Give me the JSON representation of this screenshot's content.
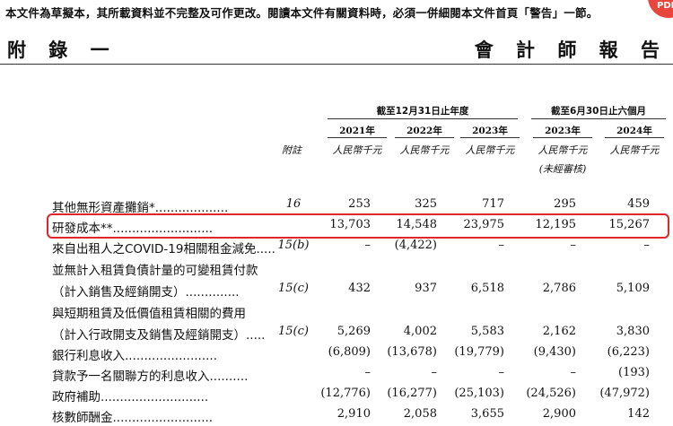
{
  "header": {
    "disclaimer": "本文件為草擬本，其所載資料並不完整及可作更改。閱讀本文件有關資料時，必須一併細閱本文件首頁「警告」一節。",
    "section_left": "附 錄 一",
    "section_right": "會 計 師 報 告"
  },
  "columns": {
    "group_year_end": "截至12月31日止年度",
    "group_six_months": "截至6月30日止六個月",
    "note_header": "附註",
    "years": [
      "2021年",
      "2022年",
      "2023年",
      "2023年",
      "2024年"
    ],
    "unit": "人民幣千元",
    "unaudited": "(未經審核)"
  },
  "rows": [
    {
      "label": "其他無形資產攤銷*...................",
      "note": "16",
      "values": [
        "253",
        "325",
        "717",
        "295",
        "459"
      ]
    },
    {
      "label": "研發成本**..........................",
      "note": "",
      "values": [
        "13,703",
        "14,548",
        "23,975",
        "12,195",
        "15,267"
      ]
    },
    {
      "label": "來自出租人之COVID-19相關租金減免.....",
      "note": "15(b)",
      "values": [
        "–",
        "(4,422)",
        "–",
        "–",
        "–"
      ]
    },
    {
      "label": "並無計入租賃負債計量的可變租賃付款",
      "note": "",
      "values": [
        "",
        "",
        "",
        "",
        ""
      ]
    },
    {
      "label": "（計入銷售及經銷開支）..............",
      "note": "15(c)",
      "values": [
        "432",
        "937",
        "6,518",
        "2,786",
        "5,109"
      ]
    },
    {
      "label": "與短期租賃及低價值租賃相關的費用",
      "note": "",
      "values": [
        "",
        "",
        "",
        "",
        ""
      ]
    },
    {
      "label": "（計入行政開支及銷售及經銷開支）.....",
      "note": "15(c)",
      "values": [
        "5,269",
        "4,002",
        "5,583",
        "2,162",
        "3,830"
      ]
    },
    {
      "label": "銀行利息收入........................",
      "note": "",
      "values": [
        "(6,809)",
        "(13,678)",
        "(19,779)",
        "(9,430)",
        "(6,223)"
      ]
    },
    {
      "label": "貸款予一名關聯方的利息收入..........",
      "note": "",
      "values": [
        "–",
        "–",
        "–",
        "–",
        "(193)"
      ]
    },
    {
      "label": "政府補助............................",
      "note": "",
      "values": [
        "(12,776)",
        "(16,277)",
        "(25,103)",
        "(24,526)",
        "(47,972)"
      ]
    },
    {
      "label": "核數師酬金..........................",
      "note": "",
      "values": [
        "2,910",
        "2,058",
        "3,655",
        "2,900",
        "142"
      ]
    }
  ]
}
